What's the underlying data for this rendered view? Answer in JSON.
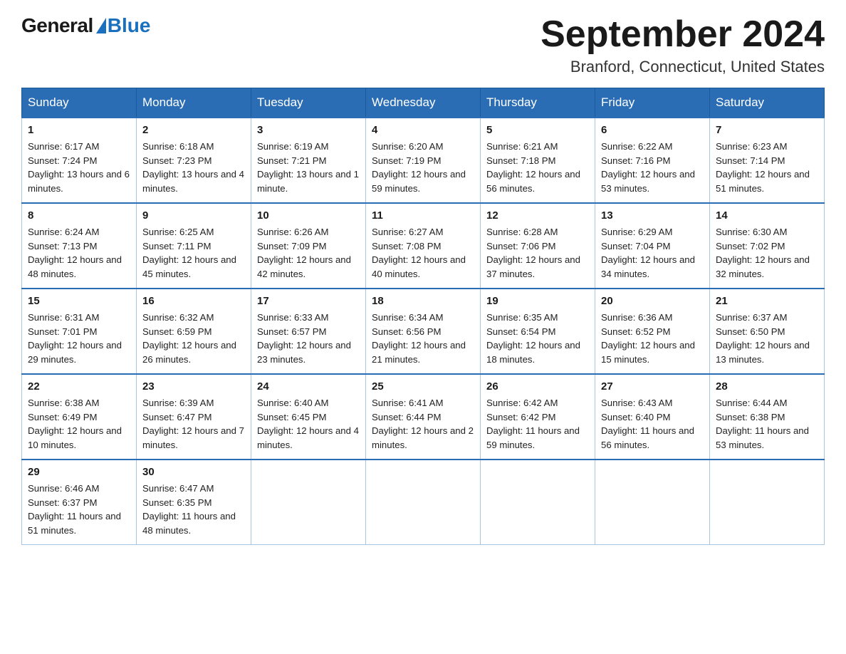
{
  "logo": {
    "general": "General",
    "blue": "Blue"
  },
  "header": {
    "title": "September 2024",
    "subtitle": "Branford, Connecticut, United States"
  },
  "weekdays": [
    "Sunday",
    "Monday",
    "Tuesday",
    "Wednesday",
    "Thursday",
    "Friday",
    "Saturday"
  ],
  "weeks": [
    [
      {
        "day": "1",
        "sunrise": "6:17 AM",
        "sunset": "7:24 PM",
        "daylight": "13 hours and 6 minutes."
      },
      {
        "day": "2",
        "sunrise": "6:18 AM",
        "sunset": "7:23 PM",
        "daylight": "13 hours and 4 minutes."
      },
      {
        "day": "3",
        "sunrise": "6:19 AM",
        "sunset": "7:21 PM",
        "daylight": "13 hours and 1 minute."
      },
      {
        "day": "4",
        "sunrise": "6:20 AM",
        "sunset": "7:19 PM",
        "daylight": "12 hours and 59 minutes."
      },
      {
        "day": "5",
        "sunrise": "6:21 AM",
        "sunset": "7:18 PM",
        "daylight": "12 hours and 56 minutes."
      },
      {
        "day": "6",
        "sunrise": "6:22 AM",
        "sunset": "7:16 PM",
        "daylight": "12 hours and 53 minutes."
      },
      {
        "day": "7",
        "sunrise": "6:23 AM",
        "sunset": "7:14 PM",
        "daylight": "12 hours and 51 minutes."
      }
    ],
    [
      {
        "day": "8",
        "sunrise": "6:24 AM",
        "sunset": "7:13 PM",
        "daylight": "12 hours and 48 minutes."
      },
      {
        "day": "9",
        "sunrise": "6:25 AM",
        "sunset": "7:11 PM",
        "daylight": "12 hours and 45 minutes."
      },
      {
        "day": "10",
        "sunrise": "6:26 AM",
        "sunset": "7:09 PM",
        "daylight": "12 hours and 42 minutes."
      },
      {
        "day": "11",
        "sunrise": "6:27 AM",
        "sunset": "7:08 PM",
        "daylight": "12 hours and 40 minutes."
      },
      {
        "day": "12",
        "sunrise": "6:28 AM",
        "sunset": "7:06 PM",
        "daylight": "12 hours and 37 minutes."
      },
      {
        "day": "13",
        "sunrise": "6:29 AM",
        "sunset": "7:04 PM",
        "daylight": "12 hours and 34 minutes."
      },
      {
        "day": "14",
        "sunrise": "6:30 AM",
        "sunset": "7:02 PM",
        "daylight": "12 hours and 32 minutes."
      }
    ],
    [
      {
        "day": "15",
        "sunrise": "6:31 AM",
        "sunset": "7:01 PM",
        "daylight": "12 hours and 29 minutes."
      },
      {
        "day": "16",
        "sunrise": "6:32 AM",
        "sunset": "6:59 PM",
        "daylight": "12 hours and 26 minutes."
      },
      {
        "day": "17",
        "sunrise": "6:33 AM",
        "sunset": "6:57 PM",
        "daylight": "12 hours and 23 minutes."
      },
      {
        "day": "18",
        "sunrise": "6:34 AM",
        "sunset": "6:56 PM",
        "daylight": "12 hours and 21 minutes."
      },
      {
        "day": "19",
        "sunrise": "6:35 AM",
        "sunset": "6:54 PM",
        "daylight": "12 hours and 18 minutes."
      },
      {
        "day": "20",
        "sunrise": "6:36 AM",
        "sunset": "6:52 PM",
        "daylight": "12 hours and 15 minutes."
      },
      {
        "day": "21",
        "sunrise": "6:37 AM",
        "sunset": "6:50 PM",
        "daylight": "12 hours and 13 minutes."
      }
    ],
    [
      {
        "day": "22",
        "sunrise": "6:38 AM",
        "sunset": "6:49 PM",
        "daylight": "12 hours and 10 minutes."
      },
      {
        "day": "23",
        "sunrise": "6:39 AM",
        "sunset": "6:47 PM",
        "daylight": "12 hours and 7 minutes."
      },
      {
        "day": "24",
        "sunrise": "6:40 AM",
        "sunset": "6:45 PM",
        "daylight": "12 hours and 4 minutes."
      },
      {
        "day": "25",
        "sunrise": "6:41 AM",
        "sunset": "6:44 PM",
        "daylight": "12 hours and 2 minutes."
      },
      {
        "day": "26",
        "sunrise": "6:42 AM",
        "sunset": "6:42 PM",
        "daylight": "11 hours and 59 minutes."
      },
      {
        "day": "27",
        "sunrise": "6:43 AM",
        "sunset": "6:40 PM",
        "daylight": "11 hours and 56 minutes."
      },
      {
        "day": "28",
        "sunrise": "6:44 AM",
        "sunset": "6:38 PM",
        "daylight": "11 hours and 53 minutes."
      }
    ],
    [
      {
        "day": "29",
        "sunrise": "6:46 AM",
        "sunset": "6:37 PM",
        "daylight": "11 hours and 51 minutes."
      },
      {
        "day": "30",
        "sunrise": "6:47 AM",
        "sunset": "6:35 PM",
        "daylight": "11 hours and 48 minutes."
      },
      null,
      null,
      null,
      null,
      null
    ]
  ]
}
